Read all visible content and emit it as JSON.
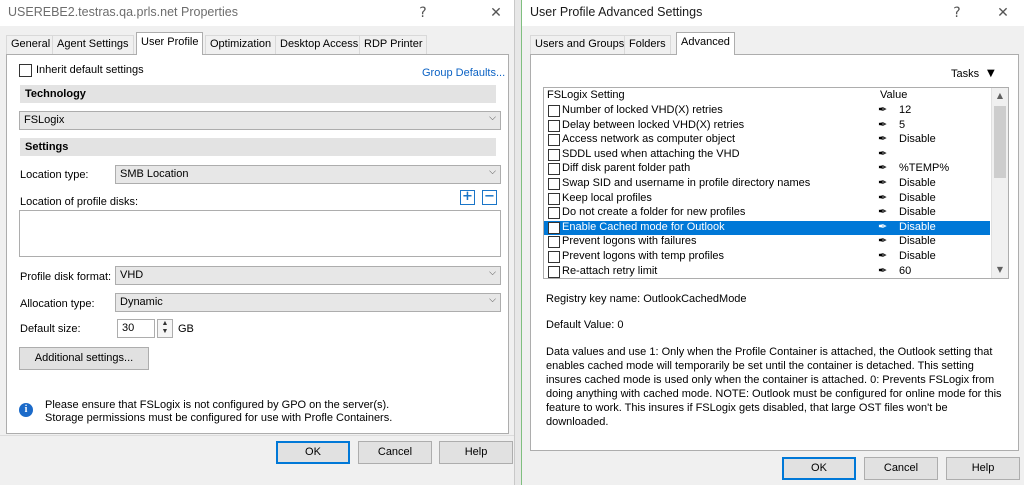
{
  "left_window": {
    "title": "USEREBE2.testras.qa.prls.net Properties",
    "help_glyph": "?",
    "close_glyph": "✕",
    "tabs": [
      "General",
      "Agent Settings",
      "User Profile",
      "Optimization",
      "Desktop Access",
      "RDP Printer"
    ],
    "active_tab": "User Profile",
    "inherit_label": "Inherit default settings",
    "inherit_checked": false,
    "group_defaults_link": "Group Defaults...",
    "technology_header": "Technology",
    "technology_value": "FSLogix",
    "settings_header": "Settings",
    "location_type_label": "Location type:",
    "location_type_value": "SMB Location",
    "location_disks_label": "Location of profile disks:",
    "add_glyph": "+",
    "remove_glyph": "−",
    "disk_format_label": "Profile disk format:",
    "disk_format_value": "VHD",
    "allocation_label": "Allocation type:",
    "allocation_value": "Dynamic",
    "default_size_label": "Default size:",
    "default_size_value": "30",
    "default_size_unit": "GB",
    "additional_settings_label": "Additional settings...",
    "info_line1": "Please ensure that FSLogix is not configured by GPO on the server(s).",
    "info_line2": "Storage permissions must be configured for use with Profle Containers.",
    "ok_label": "OK",
    "cancel_label": "Cancel",
    "help_label": "Help"
  },
  "right_window": {
    "title": "User Profile Advanced Settings",
    "help_glyph": "?",
    "close_glyph": "✕",
    "tabs": [
      "Users and Groups",
      "Folders",
      "Advanced"
    ],
    "active_tab": "Advanced",
    "tasks_label": "Tasks",
    "tasks_arrow": "▼",
    "grid": {
      "col_setting": "FSLogix Setting",
      "col_value": "Value",
      "rows": [
        {
          "name": "Number of locked VHD(X) retries",
          "value": "12",
          "selected": false
        },
        {
          "name": "Delay between locked VHD(X) retries",
          "value": "5",
          "selected": false
        },
        {
          "name": "Access network as computer object",
          "value": "Disable",
          "selected": false
        },
        {
          "name": "SDDL used when attaching the VHD",
          "value": "",
          "selected": false
        },
        {
          "name": "Diff disk parent folder path",
          "value": "%TEMP%",
          "selected": false
        },
        {
          "name": "Swap SID and username in profile directory names",
          "value": "Disable",
          "selected": false
        },
        {
          "name": "Keep local profiles",
          "value": "Disable",
          "selected": false
        },
        {
          "name": "Do not create a folder for new profiles",
          "value": "Disable",
          "selected": false
        },
        {
          "name": "Enable Cached mode for Outlook",
          "value": "Disable",
          "selected": true
        },
        {
          "name": "Prevent logons with failures",
          "value": "Disable",
          "selected": false
        },
        {
          "name": "Prevent logons with temp profiles",
          "value": "Disable",
          "selected": false
        },
        {
          "name": "Re-attach retry limit",
          "value": "60",
          "selected": false
        }
      ]
    },
    "registry_key": "Registry key name: OutlookCachedMode",
    "default_value": "Default Value: 0",
    "description": "Data values and use 1: Only when the Profile Container is attached, the Outlook setting that enables cached mode will temporarily be set until the container is detached. This setting insures cached mode is used only when the container is attached. 0: Prevents FSLogix from doing anything with cached mode. NOTE: Outlook must be configured for online mode for this feature to work. This insures if FSLogix gets disabled, that large OST files won't be downloaded.",
    "ok_label": "OK",
    "cancel_label": "Cancel",
    "help_label": "Help"
  },
  "icons": {
    "pencil": "✒",
    "chevron": "⌵",
    "scroll_up": "▲",
    "scroll_down": "▼",
    "spin_up": "▲",
    "spin_down": "▼",
    "info": "i"
  }
}
